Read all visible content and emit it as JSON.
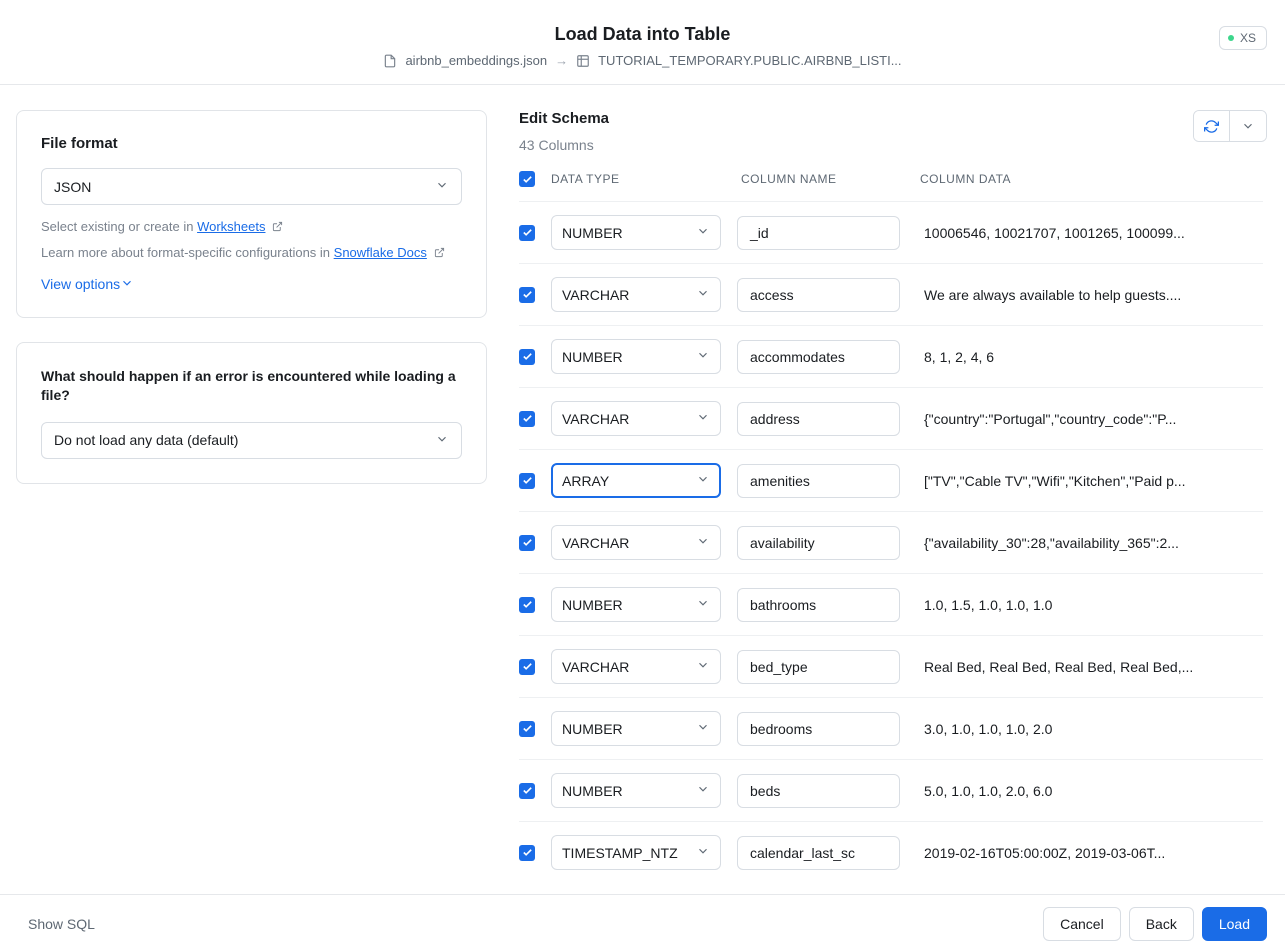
{
  "header": {
    "title": "Load Data into Table",
    "source_file": "airbnb_embeddings.json",
    "target_table": "TUTORIAL_TEMPORARY.PUBLIC.AIRBNB_LISTI...",
    "warehouse_badge": "XS"
  },
  "left": {
    "file_format": {
      "label": "File format",
      "value": "JSON",
      "helper_prefix": "Select existing or create in ",
      "worksheets_link": "Worksheets",
      "learn_prefix": "Learn more about format-specific configurations in ",
      "docs_link": "Snowflake Docs",
      "view_options": "View options"
    },
    "error_handling": {
      "question": "What should happen if an error is encountered while loading a file?",
      "value": "Do not load any data (default)"
    }
  },
  "schema": {
    "title": "Edit Schema",
    "count_label": "43 Columns",
    "headers": {
      "type": "DATA TYPE",
      "name": "COLUMN NAME",
      "data": "COLUMN DATA"
    },
    "rows": [
      {
        "type": "NUMBER",
        "name": "_id",
        "data": "10006546, 10021707, 1001265, 100099..."
      },
      {
        "type": "VARCHAR",
        "name": "access",
        "data": "We are always available to help guests...."
      },
      {
        "type": "NUMBER",
        "name": "accommodates",
        "data": "8, 1, 2, 4, 6"
      },
      {
        "type": "VARCHAR",
        "name": "address",
        "data": "{\"country\":\"Portugal\",\"country_code\":\"P..."
      },
      {
        "type": "ARRAY",
        "name": "amenities",
        "data": "[\"TV\",\"Cable TV\",\"Wifi\",\"Kitchen\",\"Paid p...",
        "focused": true
      },
      {
        "type": "VARCHAR",
        "name": "availability",
        "data": "{\"availability_30\":28,\"availability_365\":2..."
      },
      {
        "type": "NUMBER",
        "name": "bathrooms",
        "data": "1.0, 1.5, 1.0, 1.0, 1.0"
      },
      {
        "type": "VARCHAR",
        "name": "bed_type",
        "data": "Real Bed, Real Bed, Real Bed, Real Bed,..."
      },
      {
        "type": "NUMBER",
        "name": "bedrooms",
        "data": "3.0, 1.0, 1.0, 1.0, 2.0"
      },
      {
        "type": "NUMBER",
        "name": "beds",
        "data": "5.0, 1.0, 1.0, 2.0, 6.0"
      },
      {
        "type": "TIMESTAMP_NTZ",
        "name": "calendar_last_sc",
        "data": "2019-02-16T05:00:00Z, 2019-03-06T..."
      }
    ]
  },
  "footer": {
    "show_sql": "Show SQL",
    "cancel": "Cancel",
    "back": "Back",
    "load": "Load"
  }
}
